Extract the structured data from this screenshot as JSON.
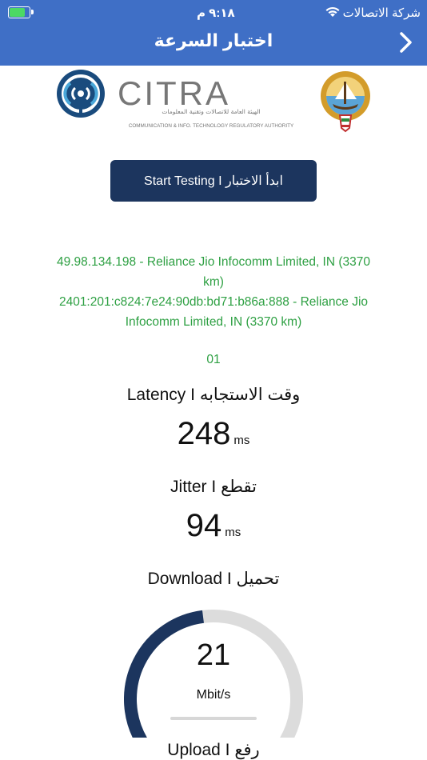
{
  "status_bar": {
    "time": "٩:١٨ م",
    "carrier": "شركة الاتصالات",
    "battery_percent": 85
  },
  "header": {
    "title": "اختبار السرعة"
  },
  "logos": {
    "citra_name": "CITRA",
    "citra_arabic": "الهيئة العامة للاتصالات وتقنية المعلومات",
    "citra_english": "COMMUNICATION & INFO. TECHNOLOGY REGULATORY AUTHORITY"
  },
  "start_button": {
    "label": "Start Testing I ابدأ الاختبار"
  },
  "server": {
    "ipv4_line1": "49.98.134.198 - Reliance Jio Infocomm Limited, IN (3370",
    "ipv4_line2": "km)",
    "ipv6_line1": "2401:201:c824:7e24:90db:bd71:b86a:888 - Reliance Jio",
    "ipv6_line2": "Infocomm Limited, IN (3370 km)"
  },
  "test_counter": "01",
  "latency": {
    "label": "Latency I وقت الاستجابه",
    "value": "248",
    "unit": "ms"
  },
  "jitter": {
    "label": "Jitter I تقطع",
    "value": "94",
    "unit": "ms"
  },
  "download": {
    "label": "Download I تحميل",
    "value": "21",
    "unit": "Mbit/s",
    "gauge_fraction": 0.47
  },
  "upload": {
    "label": "Upload I رفع"
  },
  "colors": {
    "header": "#3f6fc6",
    "button": "#1c355e",
    "accent_green": "#2ea043",
    "gauge_fill": "#1c355e",
    "gauge_track": "#dcdcdc"
  }
}
